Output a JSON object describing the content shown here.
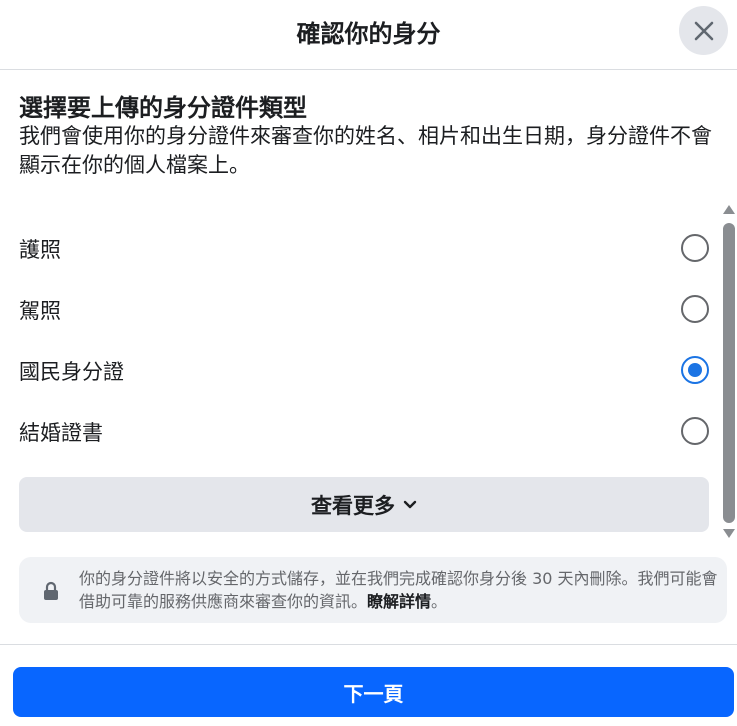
{
  "header": {
    "title": "確認你的身分"
  },
  "intro": {
    "title": "選擇要上傳的身分證件類型",
    "description": "我們會使用你的身分證件來審查你的姓名、相片和出生日期，身分證件不會顯示在你的個人檔案上。"
  },
  "options": [
    {
      "label": "護照",
      "selected": false
    },
    {
      "label": "駕照",
      "selected": false
    },
    {
      "label": "國民身分證",
      "selected": true
    },
    {
      "label": "結婚證書",
      "selected": false
    }
  ],
  "see_more": {
    "label": "查看更多"
  },
  "notice": {
    "text": "你的身分證件將以安全的方式儲存，並在我們完成確認你身分後 30 天內刪除。我們可能會借助可靠的服務供應商來審查你的資訊。",
    "link": "瞭解詳情",
    "suffix": "。"
  },
  "footer": {
    "next_label": "下一頁"
  },
  "colors": {
    "primary": "#0866ff",
    "radio_selected": "#1b74e4",
    "button_gray": "#e4e6eb",
    "notice_bg": "#f0f2f5"
  },
  "icons": {
    "close": "close-icon",
    "chevron": "chevron-down-icon",
    "lock": "lock-icon"
  }
}
